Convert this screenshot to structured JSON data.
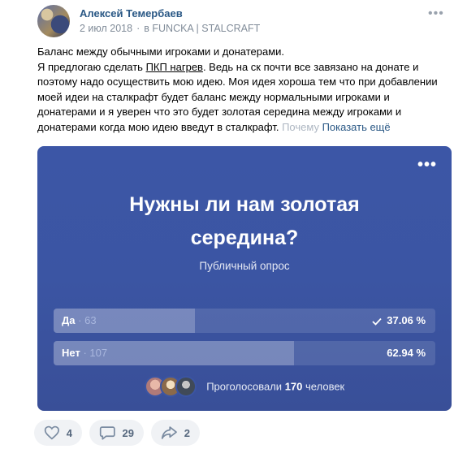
{
  "post": {
    "author": "Алексей Темербаев",
    "date": "2 июл 2018",
    "separator": "·",
    "source": "в FUNCKA | STALCRAFT",
    "menu_icon": "more-dots-icon",
    "text_lines": [
      "Баланс между обычными игроками и донатерами.",
      "Я предлогаю сделать ",
      "ПКП нагрев",
      ". Ведь на ск почти все завязано на донате и",
      "поэтому надо осуществить мою идею. Моя идея хороша тем что при добавлении",
      "моей идеи на сталкрафт будет баланс между нормальными игроками и",
      "донатерами и я уверен что это будет золотая середина между игроками и",
      "донатерами когда мою идею введут в сталкрафт. ",
      "Почему",
      "Показать ещё"
    ]
  },
  "poll": {
    "question": "Нужны ли нам золотая середина?",
    "type": "Публичный опрос",
    "options": [
      {
        "label": "Да",
        "count": "63",
        "percent_text": "37.06 %",
        "fraction": 0.3706,
        "selected": true
      },
      {
        "label": "Нет",
        "count": "107",
        "percent_text": "62.94 %",
        "fraction": 0.6294,
        "selected": false
      }
    ],
    "count_separator": "·",
    "voters_prefix": "Проголосовали",
    "voters_count": "170",
    "voters_suffix": "человек",
    "colors": {
      "background": "#3b55a3",
      "fill": "rgba(255,255,255,0.22)"
    }
  },
  "actions": {
    "like_count": "4",
    "comment_count": "29",
    "share_count": "2",
    "like_icon": "heart-icon",
    "comment_icon": "comment-icon",
    "share_icon": "share-icon"
  }
}
